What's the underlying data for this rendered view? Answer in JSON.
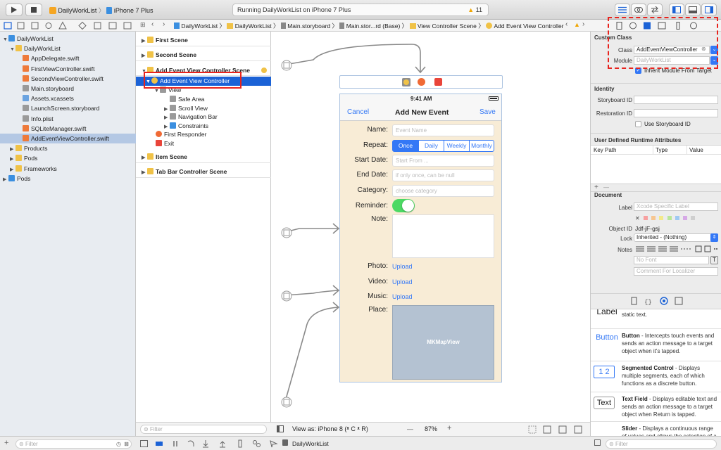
{
  "toolbar": {
    "scheme": "DailyWorkList",
    "device": "iPhone 7 Plus",
    "status_text": "Running DailyWorkList on iPhone 7 Plus",
    "warning_count": "11"
  },
  "navigator": {
    "items": [
      {
        "label": "DailyWorkList",
        "level": 0,
        "icon": "project-icon"
      },
      {
        "label": "DailyWorkList",
        "level": 1,
        "icon": "folder-icon"
      },
      {
        "label": "AppDelegate.swift",
        "level": 2,
        "icon": "swift-file-icon"
      },
      {
        "label": "FirstViewController.swift",
        "level": 2,
        "icon": "swift-file-icon"
      },
      {
        "label": "SecondViewController.swift",
        "level": 2,
        "icon": "swift-file-icon"
      },
      {
        "label": "Main.storyboard",
        "level": 2,
        "icon": "storyboard-icon"
      },
      {
        "label": "Assets.xcassets",
        "level": 2,
        "icon": "assets-icon"
      },
      {
        "label": "LaunchScreen.storyboard",
        "level": 2,
        "icon": "storyboard-icon"
      },
      {
        "label": "Info.plist",
        "level": 2,
        "icon": "plist-icon"
      },
      {
        "label": "SQLiteManager.swift",
        "level": 2,
        "icon": "swift-file-icon"
      },
      {
        "label": "AddEventViewController.swift",
        "level": 2,
        "icon": "swift-file-icon"
      },
      {
        "label": "Products",
        "level": 1,
        "icon": "folder-icon"
      },
      {
        "label": "Pods",
        "level": 1,
        "icon": "folder-icon"
      },
      {
        "label": "Frameworks",
        "level": 1,
        "icon": "folder-icon"
      },
      {
        "label": "Pods",
        "level": 0,
        "icon": "project-icon"
      }
    ],
    "filter_placeholder": "Filter"
  },
  "jumpbar": {
    "crumbs": [
      "DailyWorkList",
      "DailyWorkList",
      "Main.storyboard",
      "Main.stor...rd (Base)",
      "View Controller Scene",
      "Add Event View Controller"
    ]
  },
  "outline": {
    "items": [
      {
        "label": "First Scene"
      },
      {
        "label": "Second Scene"
      },
      {
        "label": "Add Event View Controller Scene"
      },
      {
        "label": "Add Event View Controller"
      },
      {
        "label": "View"
      },
      {
        "label": "Safe Area"
      },
      {
        "label": "Scroll View"
      },
      {
        "label": "Navigation Bar"
      },
      {
        "label": "Constraints"
      },
      {
        "label": "First Responder"
      },
      {
        "label": "Exit"
      },
      {
        "label": "Item Scene"
      },
      {
        "label": "Tab Bar Controller Scene"
      }
    ],
    "filter_placeholder": "Filter"
  },
  "iphone": {
    "time": "9:41 AM",
    "cancel": "Cancel",
    "title": "Add New Event",
    "save": "Save",
    "name_label": "Name:",
    "name_placeholder": "Event Name",
    "repeat_label": "Repeat:",
    "repeat_options": [
      "Once",
      "Daily",
      "Weekly",
      "Monthly"
    ],
    "start_label": "Start Date:",
    "start_placeholder": "Start From ...",
    "end_label": "End Date:",
    "end_placeholder": "if only once, can be null",
    "category_label": "Category:",
    "category_placeholder": "choose category",
    "reminder_label": "Reminder:",
    "note_label": "Note:",
    "photo_label": "Photo:",
    "video_label": "Video:",
    "music_label": "Music:",
    "upload": "Upload",
    "place_label": "Place:",
    "map_label": "MKMapView"
  },
  "canvas_bottom": {
    "view_as": "View as: iPhone 8 (ᵜ C ᵜ R)",
    "zoom": "87%",
    "minus": "—",
    "plus": "+"
  },
  "debug_bar": {
    "target": "DailyWorkList"
  },
  "inspector": {
    "custom_class_header": "Custom Class",
    "class_label": "Class",
    "class_value": "AddEventViewController",
    "module_label": "Module",
    "module_placeholder": "DailyWorkList",
    "inherit_label": "Inherit Module From Target",
    "identity_header": "Identity",
    "storyboard_id_label": "Storyboard ID",
    "restoration_id_label": "Restoration ID",
    "use_storyboard_id": "Use Storyboard ID",
    "runtime_header": "User Defined Runtime Attributes",
    "col_keypath": "Key Path",
    "col_type": "Type",
    "col_value": "Value",
    "add": "+",
    "remove": "—",
    "document_header": "Document",
    "label_label": "Label",
    "label_placeholder": "Xcode Specific Label",
    "object_id_label": "Object ID",
    "object_id_value": "Jdf-jF-gsj",
    "lock_label": "Lock",
    "lock_value": "Inherited - (Nothing)",
    "notes_label": "Notes",
    "no_font": "No Font",
    "comment_placeholder": "Comment For Localizer",
    "filter_placeholder": "Filter"
  },
  "library": {
    "items": [
      {
        "preview": "Label",
        "title": "",
        "desc": "static text."
      },
      {
        "preview": "Button",
        "title": "Button",
        "desc": " - Intercepts touch events and sends an action message to a target object when it's tapped."
      },
      {
        "preview": "1 2",
        "title": "Segmented Control",
        "desc": " - Displays multiple segments, each of which functions as a discrete button."
      },
      {
        "preview": "Text",
        "title": "Text Field",
        "desc": " - Displays editable text and sends an action message to a target object when Return is tapped."
      },
      {
        "preview": "",
        "title": "Slider",
        "desc": " - Displays a continuous range of values and allows the selection of a single value."
      }
    ]
  },
  "colors": {
    "accent": "#3478f6",
    "selection": "#1b62d6",
    "scene_bg": "#f8ecd6",
    "map_bg": "#b4c2d2",
    "switch_on": "#4cd964",
    "highlight_red": "#e8231d"
  }
}
